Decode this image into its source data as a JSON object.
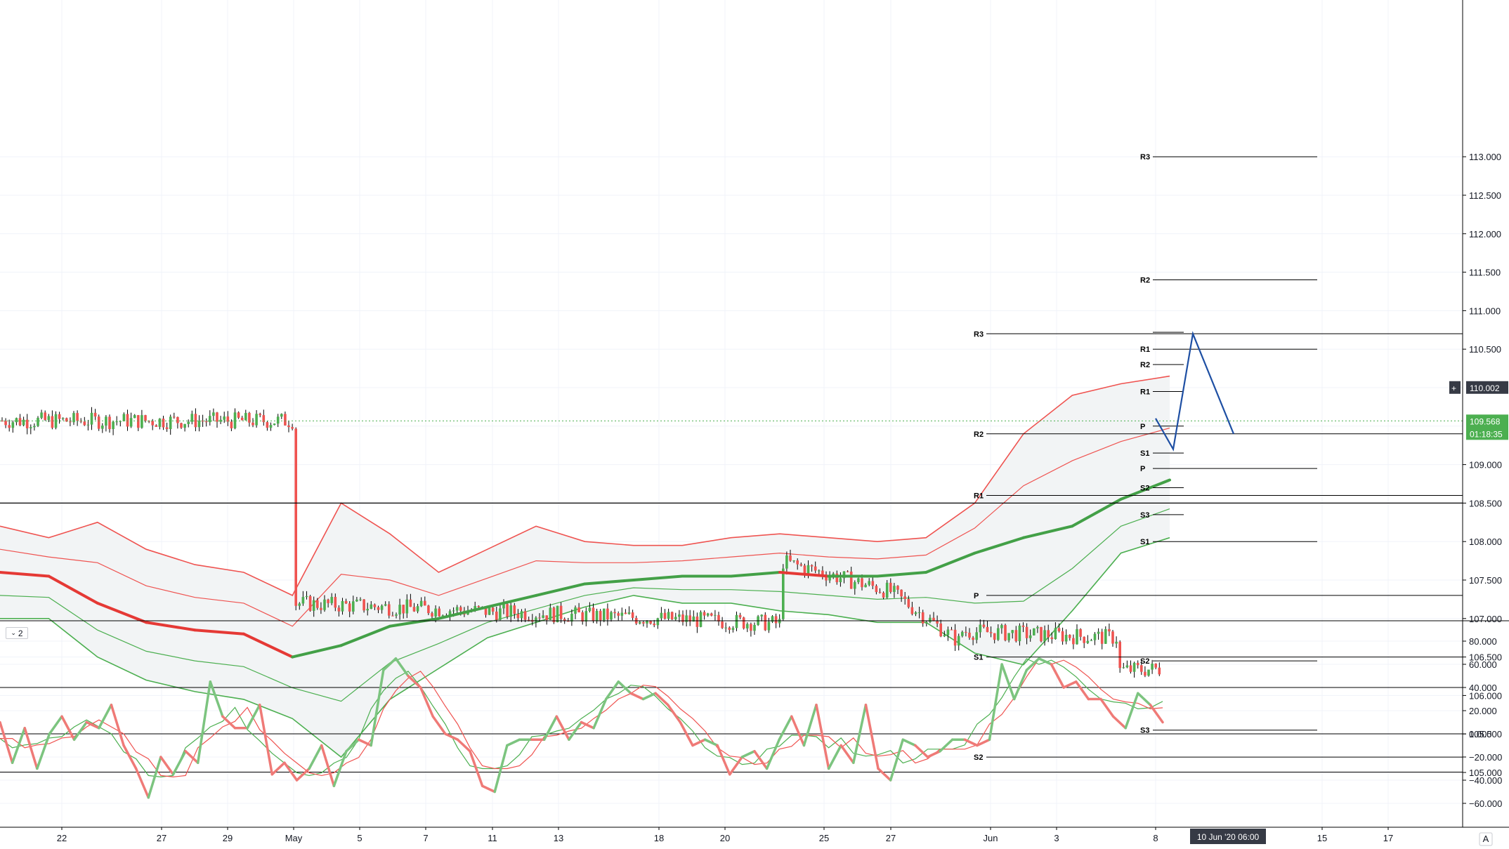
{
  "pane_toggle": {
    "icon": "chevron-down-icon",
    "label": "2"
  },
  "price_scale": {
    "labels": [
      "113.000",
      "112.500",
      "112.000",
      "111.500",
      "111.000",
      "110.500",
      "110.002",
      "109.568",
      "01:18:35",
      "109.000",
      "108.500",
      "108.000",
      "107.500",
      "107.000",
      "106.500",
      "106.000",
      "105.500",
      "105.000"
    ],
    "crosshair_price": "110.002",
    "last_price": "109.568",
    "countdown": "01:18:35",
    "range": [
      105.0,
      113.0
    ]
  },
  "osc_scale": {
    "labels": [
      "80.000",
      "60.000",
      "40.000",
      "20.000",
      "0.000",
      "−20.000",
      "−40.000",
      "−60.000"
    ],
    "range": [
      -60,
      80
    ],
    "levels": [
      40,
      0,
      -33
    ]
  },
  "time_axis": {
    "labels": [
      "22",
      "27",
      "29",
      "May",
      "5",
      "7",
      "11",
      "13",
      "18",
      "20",
      "25",
      "27",
      "Jun",
      "3",
      "8",
      "15",
      "17"
    ],
    "crosshair_time": "10 Jun '20   06:00"
  },
  "auto_button": "A",
  "colors": {
    "bull": "#4caf50",
    "bear": "#ef5350",
    "basis_up": "#43a047",
    "basis_down": "#e53935",
    "projection": "#1e4fa3",
    "lines": "#000000"
  },
  "chart_data": [
    {
      "type": "candlestick",
      "title": "",
      "ylim": [
        105.0,
        113.0
      ],
      "x_ticks": [
        "22",
        "27",
        "29",
        "May",
        "5",
        "7",
        "11",
        "13",
        "18",
        "20",
        "25",
        "27",
        "Jun",
        "3",
        "8",
        "15",
        "17"
      ],
      "close_path": [
        [
          "22",
          107.75
        ],
        [
          "27",
          107.35
        ],
        [
          "29",
          106.7
        ],
        [
          "May",
          107.2
        ],
        [
          "5",
          106.75
        ],
        [
          "7",
          106.05
        ],
        [
          "9",
          106.35
        ],
        [
          "11",
          107.7
        ],
        [
          "13",
          107.3
        ],
        [
          "15",
          106.95
        ],
        [
          "18",
          107.15
        ],
        [
          "19",
          107.85
        ],
        [
          "20",
          107.65
        ],
        [
          "22",
          107.45
        ],
        [
          "25",
          107.65
        ],
        [
          "26",
          107.75
        ],
        [
          "27",
          107.55
        ],
        [
          "28",
          107.75
        ],
        [
          "29",
          107.35
        ],
        [
          "Jun",
          107.55
        ],
        [
          "2",
          108.3
        ],
        [
          "3",
          108.65
        ],
        [
          "4",
          108.9
        ],
        [
          "5",
          109.1
        ],
        [
          "6",
          109.65
        ],
        [
          "8",
          109.57
        ]
      ],
      "bollinger": {
        "upper": [
          108.2,
          108.05,
          108.25,
          107.9,
          107.7,
          107.6,
          107.3,
          108.5,
          108.1,
          107.6,
          107.9,
          108.2,
          108.0,
          107.95,
          107.95,
          108.05,
          108.1,
          108.05,
          108.0,
          108.05,
          108.5,
          109.4,
          109.9,
          110.05,
          110.15
        ],
        "basis": [
          107.6,
          107.55,
          107.2,
          106.95,
          106.85,
          106.8,
          106.5,
          106.65,
          106.9,
          107.0,
          107.15,
          107.3,
          107.45,
          107.5,
          107.55,
          107.55,
          107.6,
          107.55,
          107.55,
          107.6,
          107.85,
          108.05,
          108.2,
          108.55,
          108.8
        ],
        "lower": [
          107.0,
          107.0,
          106.5,
          106.2,
          106.05,
          105.95,
          105.7,
          105.2,
          105.95,
          106.35,
          106.75,
          106.95,
          107.15,
          107.3,
          107.2,
          107.2,
          107.1,
          107.05,
          106.95,
          106.95,
          106.55,
          106.4,
          107.1,
          107.85,
          108.05
        ]
      },
      "pivots": [
        {
          "label": "R3",
          "value": 113.0
        },
        {
          "label": "R2",
          "value": 111.4
        },
        {
          "label": "R3",
          "value": 110.7
        },
        {
          "label": "R1",
          "value": 110.5
        },
        {
          "label": "R2",
          "value": 110.3
        },
        {
          "label": "R1",
          "value": 109.95
        },
        {
          "label": "P",
          "value": 109.5
        },
        {
          "label": "R2",
          "value": 109.4
        },
        {
          "label": "S1",
          "value": 109.15
        },
        {
          "label": "P",
          "value": 108.95
        },
        {
          "label": "S2",
          "value": 108.7
        },
        {
          "label": "R1",
          "value": 108.6
        },
        {
          "label": "S3",
          "value": 108.35
        },
        {
          "label": "S1",
          "value": 108.0
        },
        {
          "label": "P",
          "value": 107.3
        },
        {
          "label": "S1",
          "value": 106.5
        },
        {
          "label": "S2",
          "value": 106.45
        },
        {
          "label": "S3",
          "value": 105.55
        },
        {
          "label": "S2",
          "value": 105.2
        }
      ],
      "horizontal_line": 108.5,
      "projection": [
        [
          "8",
          109.6
        ],
        [
          "9",
          109.2
        ],
        [
          "10",
          110.7
        ],
        [
          "11",
          109.4
        ]
      ]
    },
    {
      "type": "line",
      "title": "",
      "ylim": [
        -60,
        80
      ],
      "series": [
        {
          "name": "",
          "values": [
            10,
            -25,
            5,
            -30,
            0,
            15,
            -5,
            10,
            5,
            25,
            -10,
            -30,
            -55,
            -20,
            -35,
            -15,
            -25,
            45,
            15,
            5,
            5,
            25,
            -35,
            -25,
            -40,
            -30,
            -10,
            -45,
            -15,
            -5,
            -10,
            55,
            65,
            50,
            40,
            15,
            0,
            -5,
            -15,
            -45,
            -50,
            -10,
            -5,
            -5,
            -5,
            15,
            -5,
            10,
            5,
            30,
            45,
            35,
            30,
            35,
            25,
            10,
            -10,
            -5,
            -10,
            -35,
            -20,
            -15,
            -30,
            -5,
            15,
            -10,
            25,
            -30,
            -10,
            -25,
            25,
            -30,
            -40,
            -5,
            -10,
            -20,
            -15,
            -5,
            -5,
            -10,
            -5,
            60,
            30,
            55,
            65,
            60,
            40,
            45,
            30,
            30,
            15,
            5,
            35,
            25,
            10
          ]
        }
      ]
    }
  ]
}
